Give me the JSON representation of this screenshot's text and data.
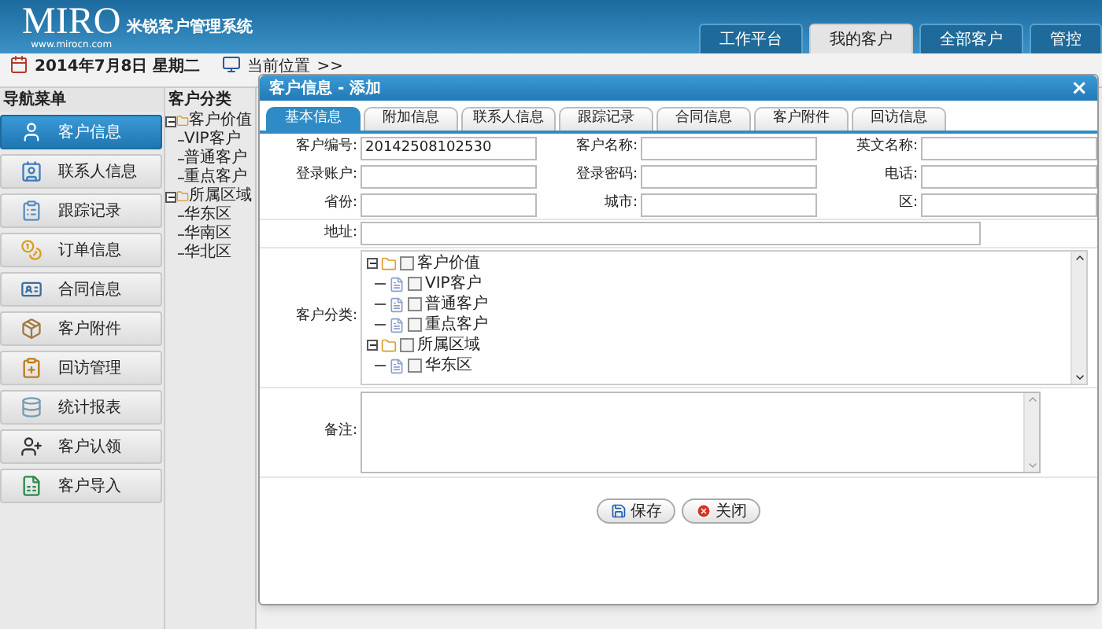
{
  "header": {
    "logo": "MIRO",
    "site": "www.mirocn.com",
    "app_title": "米锐客户管理系统",
    "tabs": [
      {
        "label": "工作平台",
        "selected": false
      },
      {
        "label": "我的客户",
        "selected": true
      },
      {
        "label": "全部客户",
        "selected": false
      },
      {
        "label": "管控",
        "selected": false
      }
    ]
  },
  "date_bar": {
    "date": "2014年7月8日 星期二",
    "location_label": "当前位置",
    "separator": ">>"
  },
  "nav": {
    "title": "导航菜单",
    "items": [
      {
        "label": "客户信息",
        "selected": true
      },
      {
        "label": "联系人信息",
        "selected": false
      },
      {
        "label": "跟踪记录",
        "selected": false
      },
      {
        "label": "订单信息",
        "selected": false
      },
      {
        "label": "合同信息",
        "selected": false
      },
      {
        "label": "客户附件",
        "selected": false
      },
      {
        "label": "回访管理",
        "selected": false
      },
      {
        "label": "统计报表",
        "selected": false
      },
      {
        "label": "客户认领",
        "selected": false
      },
      {
        "label": "客户导入",
        "selected": false
      }
    ]
  },
  "category_panel": {
    "title": "客户分类",
    "tree": [
      {
        "label": "客户价值",
        "expanded": true,
        "children": [
          {
            "label": "VIP客户"
          },
          {
            "label": "普通客户"
          },
          {
            "label": "重点客户"
          }
        ]
      },
      {
        "label": "所属区域",
        "expanded": true,
        "children": [
          {
            "label": "华东区"
          },
          {
            "label": "华南区"
          },
          {
            "label": "华北区"
          }
        ]
      }
    ]
  },
  "dialog": {
    "title": "客户信息 - 添加",
    "close": "×",
    "tabs": [
      {
        "label": "基本信息",
        "selected": true
      },
      {
        "label": "附加信息",
        "selected": false
      },
      {
        "label": "联系人信息",
        "selected": false
      },
      {
        "label": "跟踪记录",
        "selected": false
      },
      {
        "label": "合同信息",
        "selected": false
      },
      {
        "label": "客户附件",
        "selected": false
      },
      {
        "label": "回访信息",
        "selected": false
      }
    ],
    "fields": [
      {
        "label": "客户编号:",
        "value": "20142508102530"
      },
      {
        "label": "客户名称:"
      },
      {
        "label": "英文名称:"
      },
      {
        "label": "登录账户:"
      },
      {
        "label": "登录密码:"
      },
      {
        "label": "电话:"
      },
      {
        "label": "省份:"
      },
      {
        "label": "城市:"
      },
      {
        "label": "区:"
      }
    ],
    "address": {
      "label": "地址:"
    },
    "category": {
      "label": "客户分类:",
      "tree": [
        {
          "label": "客户价值",
          "checked": false,
          "expanded": true,
          "children": [
            {
              "label": "VIP客户",
              "checked": false
            },
            {
              "label": "普通客户",
              "checked": false
            },
            {
              "label": "重点客户",
              "checked": false
            }
          ]
        },
        {
          "label": "所属区域",
          "checked": false,
          "expanded": true,
          "children": [
            {
              "label": "华东区",
              "checked": false
            }
          ]
        }
      ]
    },
    "remarks": {
      "label": "备注:"
    },
    "buttons": [
      {
        "label": "保存",
        "kind": "save"
      },
      {
        "label": "关闭",
        "kind": "close"
      }
    ]
  }
}
